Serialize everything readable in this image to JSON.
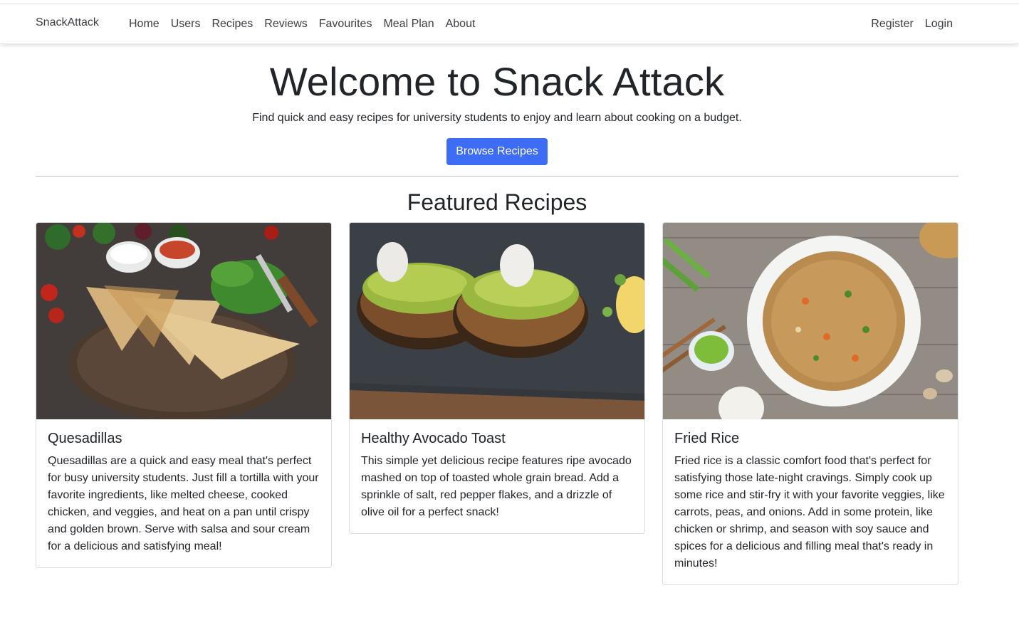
{
  "navbar": {
    "brand": "SnackAttack",
    "links": [
      "Home",
      "Users",
      "Recipes",
      "Reviews",
      "Favourites",
      "Meal Plan",
      "About"
    ],
    "auth": [
      "Register",
      "Login"
    ]
  },
  "hero": {
    "title": "Welcome to Snack Attack",
    "subtitle": "Find quick and easy recipes for university students to enjoy and learn about cooking on a budget.",
    "button": "Browse Recipes"
  },
  "featured": {
    "title": "Featured Recipes",
    "cards": [
      {
        "title": "Quesadillas",
        "text": "Quesadillas are a quick and easy meal that's perfect for busy university students. Just fill a tortilla with your favorite ingredients, like melted cheese, cooked chicken, and veggies, and heat on a pan until crispy and golden brown. Serve with salsa and sour cream for a delicious and satisfying meal!"
      },
      {
        "title": "Healthy Avocado Toast",
        "text": "This simple yet delicious recipe features ripe avocado mashed on top of toasted whole grain bread. Add a sprinkle of salt, red pepper flakes, and a drizzle of olive oil for a perfect snack!"
      },
      {
        "title": "Fried Rice",
        "text": "Fried rice is a classic comfort food that's perfect for satisfying those late-night cravings. Simply cook up some rice and stir-fry it with your favorite veggies, like carrots, peas, and onions. Add in some protein, like chicken or shrimp, and season with soy sauce and spices for a delicious and filling meal that's ready in minutes!"
      }
    ]
  },
  "colors": {
    "primary": "#3d6cf5",
    "text": "#212529",
    "border": "#d9dcdf"
  }
}
